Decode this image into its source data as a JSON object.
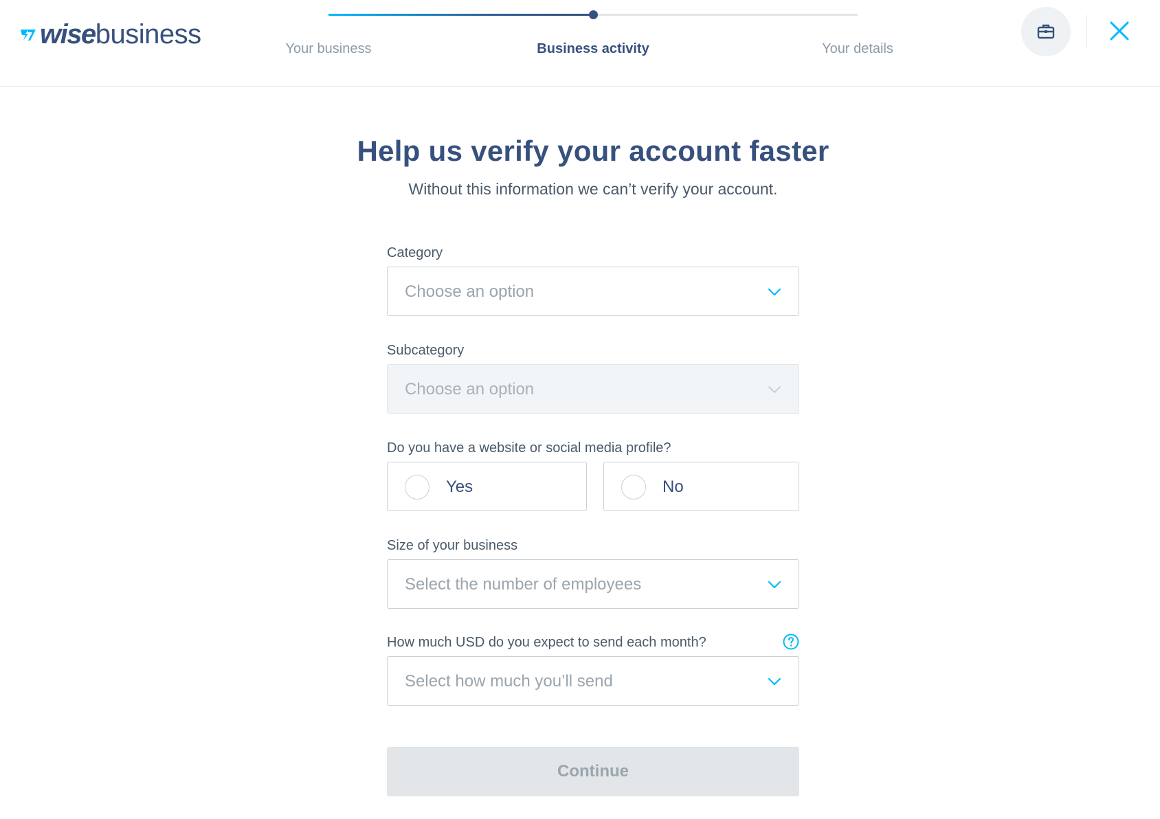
{
  "header": {
    "logo": {
      "wise": "wise",
      "business": "business"
    },
    "steps": [
      {
        "label": "Your business",
        "state": "done"
      },
      {
        "label": "Business activity",
        "state": "active"
      },
      {
        "label": "Your details",
        "state": "upcoming"
      }
    ],
    "progress_fraction": 0.5,
    "icons": {
      "profile": "briefcase-icon",
      "close": "close-icon"
    },
    "colors": {
      "accent": "#00b9ff",
      "navy": "#37517e"
    }
  },
  "main": {
    "title": "Help us verify your account faster",
    "subtitle": "Without this information we can’t verify your account.",
    "category": {
      "label": "Category",
      "placeholder": "Choose an option"
    },
    "subcategory": {
      "label": "Subcategory",
      "placeholder": "Choose an option",
      "disabled": true
    },
    "website": {
      "label": "Do you have a website or social media profile?",
      "options": [
        "Yes",
        "No"
      ]
    },
    "size": {
      "label": "Size of your business",
      "placeholder": "Select the number of employees"
    },
    "volume": {
      "label": "How much USD do you expect to send each month?",
      "placeholder": "Select how much you’ll send"
    },
    "continue_label": "Continue"
  }
}
